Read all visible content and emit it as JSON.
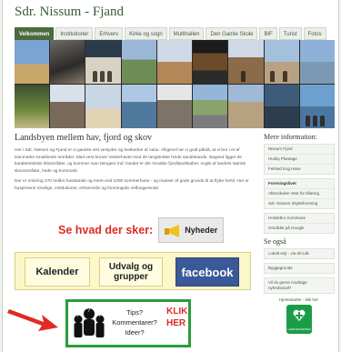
{
  "site": {
    "title": "Sdr. Nissum - Fjand"
  },
  "nav": {
    "tabs": [
      {
        "label": "Velkommen",
        "active": true
      },
      {
        "label": "Institutioner"
      },
      {
        "label": "Erhverv"
      },
      {
        "label": "Kirke og sogn"
      },
      {
        "label": "Multihallen"
      },
      {
        "label": "Den Gamle Skole"
      },
      {
        "label": "BIF"
      },
      {
        "label": "Turist"
      },
      {
        "label": "Fotos"
      }
    ]
  },
  "main": {
    "heading": "Landsbyen mellem hav, fjord og skov",
    "para1": "Her i Sdr. Nissum og Fjand er vi ganske vist vestyder og beskedne af natur. Alligevel tør vi godt påstå, at vi bor i et af Danmarks smukkeste områder. Med vest bruser Vesterhavet med de langstrakte hvide sandstrande. Bagved ligger de karakteristiske klitområder, og kommer man længere ind i landet er der smukke fjordlandskaber, nogle af landets største skovområder, hede og kornmark.",
    "para2": "Der er omkring 270 helårs husstande og mere end 1000 sommerhuse - og masser af gode grunde til at flytte hertil. Her er husprisene rimelige, institutioner, erhvervsliv og foreningsliv velfungerende."
  },
  "see": {
    "text": "Se hvad der sker:",
    "news_label": "Nyheder"
  },
  "links": {
    "calendar": "Kalender",
    "groups": "Udvalg og grupper",
    "facebook": "facebook"
  },
  "tips": {
    "text_lines": [
      "Tips?",
      "Kommentarer?",
      "Ideer?"
    ],
    "klik": "KLIK",
    "her": "HER"
  },
  "sidebar": {
    "more_title": "Mere information:",
    "group1": [
      "Nissum Fjord",
      "Husby Plantage",
      "Felsted Kog Have"
    ],
    "group2_title": "Foreningslivet",
    "group2": [
      "Aftenskolen Vest for tilføring",
      "Sdr. Nissum Skytteforening"
    ],
    "group3": [
      "Holstebro Kommune",
      "Området på Google"
    ],
    "also_title": "Se også",
    "group4": [
      "Lokalt vejr - via dmi.dk"
    ],
    "group5": [
      "Byggegrunde"
    ],
    "group6": [
      "Vil du gerne modtage nyhedsmail?"
    ],
    "heartstarter": "Hjertestarter - klik her:",
    "aed_label": "HJERTESTARTER"
  },
  "colors": {
    "brand_green": "#4b6b3e",
    "accent_red": "#e02a22",
    "tips_border": "#2b9c3a",
    "facebook_blue": "#3b5998",
    "link_box_bg": "#fbf7c9"
  }
}
